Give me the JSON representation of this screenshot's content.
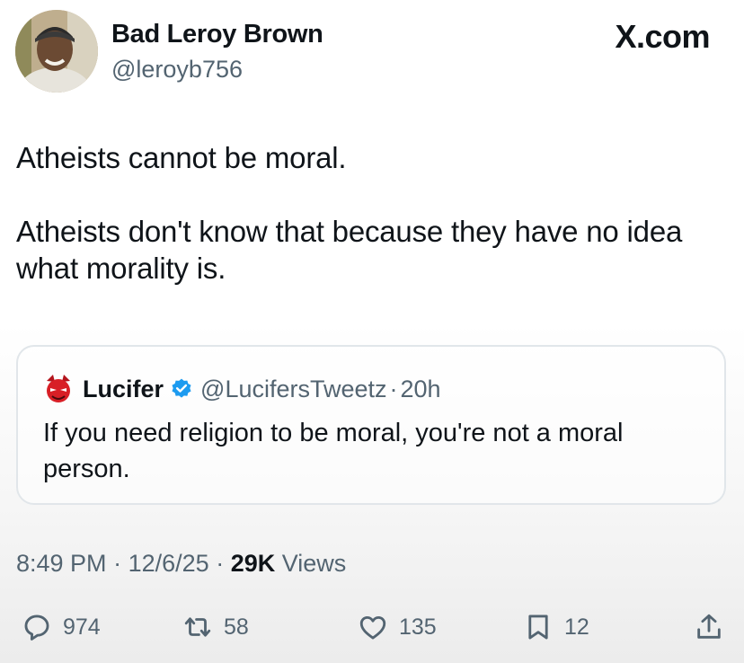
{
  "header": {
    "display_name": "Bad Leroy Brown",
    "handle": "@leroyb756",
    "brand": "X.com"
  },
  "tweet": {
    "paragraphs": [
      "Atheists cannot be moral.",
      "Atheists don't know that because they have no idea what morality is."
    ]
  },
  "quote": {
    "name": "Lucifer",
    "verified": true,
    "handle": "@LucifersTweetz",
    "separator": "·",
    "time": "20h",
    "text": "If you need religion to be moral, you're not a moral person."
  },
  "meta": {
    "time": "8:49 PM",
    "date": "12/6/25",
    "views_count": "29K",
    "views_label": "Views",
    "separator": "·"
  },
  "actions": {
    "replies": "974",
    "reposts": "58",
    "likes": "135",
    "bookmarks": "12"
  },
  "icons": {
    "reply": "reply-icon",
    "repost": "repost-icon",
    "like": "heart-icon",
    "bookmark": "bookmark-icon",
    "share": "share-icon",
    "verified": "verified-badge-icon"
  },
  "colors": {
    "text": "#0f1419",
    "secondary": "#536471",
    "verified_blue": "#1d9bf0",
    "quote_border": "#e1e6ea"
  }
}
